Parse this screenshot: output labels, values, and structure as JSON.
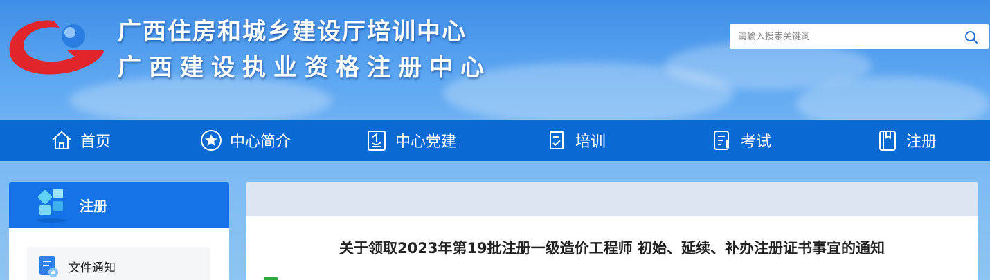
{
  "header": {
    "title_line1": "广西住房和城乡建设厅培训中心",
    "title_line2": "广西建设执业资格注册中心",
    "logo_icon": "g-globe-logo-icon"
  },
  "search": {
    "placeholder": "请输入搜索关键词",
    "value": "",
    "icon": "search-icon"
  },
  "nav": {
    "items": [
      {
        "label": "首页",
        "icon": "home-icon"
      },
      {
        "label": "中心简介",
        "icon": "star-circle-icon"
      },
      {
        "label": "中心党建",
        "icon": "party-document-icon"
      },
      {
        "label": "培训",
        "icon": "clipboard-check-icon"
      },
      {
        "label": "考试",
        "icon": "exam-paper-icon"
      },
      {
        "label": "注册",
        "icon": "book-bookmark-icon"
      }
    ]
  },
  "sidebar": {
    "title": "注册",
    "items": [
      {
        "label": "文件通知",
        "icon": "document-notice-icon"
      }
    ]
  },
  "article": {
    "title": "关于领取2023年第19批注册一级造价工程师 初始、延续、补办注册证书事宜的通知"
  },
  "colors": {
    "nav_bg": "#0a6ad4",
    "sidebar_header_bg": "#1473e6",
    "panel_top_bg": "#dde4f2",
    "logo_red": "#e0262b",
    "logo_blue": "#2a7de1"
  }
}
